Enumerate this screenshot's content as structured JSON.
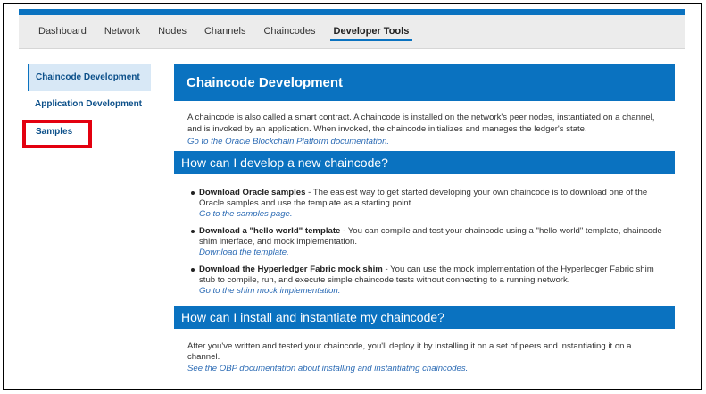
{
  "nav": {
    "tabs": [
      {
        "label": "Dashboard"
      },
      {
        "label": "Network"
      },
      {
        "label": "Nodes"
      },
      {
        "label": "Channels"
      },
      {
        "label": "Chaincodes"
      },
      {
        "label": "Developer Tools",
        "active": true
      }
    ]
  },
  "sidebar": {
    "items": [
      {
        "label": "Chaincode Development",
        "active": true
      },
      {
        "label": "Application Development"
      },
      {
        "label": "Samples",
        "highlighted": true
      }
    ]
  },
  "main": {
    "title": "Chaincode Development",
    "intro": "A chaincode is also called a smart contract. A chaincode is installed on the network's peer nodes, instantiated on a channel, and is invoked by an application. When invoked, the chaincode initializes and manages the ledger's state.",
    "intro_link": "Go to the Oracle Blockchain Platform documentation.",
    "section1": {
      "heading": "How can I develop a new chaincode?",
      "items": [
        {
          "title": "Download Oracle samples",
          "text": " - The easiest way to get started developing your own chaincode is to download one of the Oracle samples and use the template as a starting point.",
          "link": "Go to the samples page."
        },
        {
          "title": "Download a \"hello world\" template",
          "text": " - You can compile and test your chaincode using a \"hello world\" template, chaincode shim interface, and mock implementation.",
          "link": "Download the template."
        },
        {
          "title": "Download the Hyperledger Fabric mock shim",
          "text": " - You can use the mock implementation of the Hyperledger Fabric shim stub to compile, run, and execute simple chaincode tests without connecting to a running network.",
          "link": "Go to the shim mock implementation."
        }
      ]
    },
    "section2": {
      "heading": "How can I install and instantiate my chaincode?",
      "text": "After you've written and tested your chaincode, you'll deploy it by installing it on a set of peers and instantiating it on a channel.",
      "link": "See the OBP documentation about installing and instantiating chaincodes."
    }
  },
  "colors": {
    "accent": "#0a72c0",
    "highlight": "#e3000f",
    "link": "#2a6ab4"
  }
}
